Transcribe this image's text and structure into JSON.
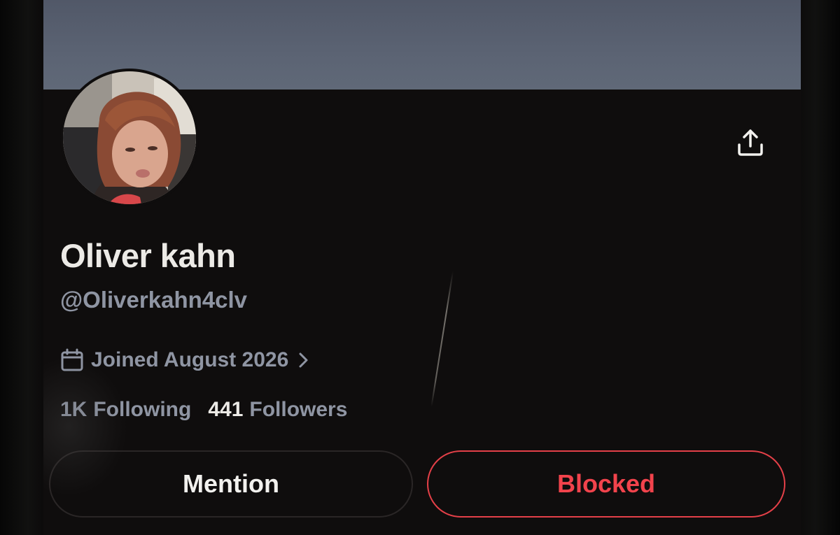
{
  "profile": {
    "name": "Oliver kahn",
    "handle": "@Oliverkahn4clv",
    "joined": "Joined August 2026",
    "following_count": "1K",
    "following_label": "Following",
    "followers_count": "441",
    "followers_label": "Followers"
  },
  "actions": {
    "mention_label": "Mention",
    "blocked_label": "Blocked"
  },
  "icons": {
    "share": "share-upload-icon",
    "calendar": "calendar-icon",
    "chevron": "chevron-right-icon"
  },
  "colors": {
    "background": "#0f0d0d",
    "banner": "#5b6373",
    "primary_text": "#eceae6",
    "secondary_text": "#8f95a3",
    "blocked_red": "#f2434c"
  }
}
